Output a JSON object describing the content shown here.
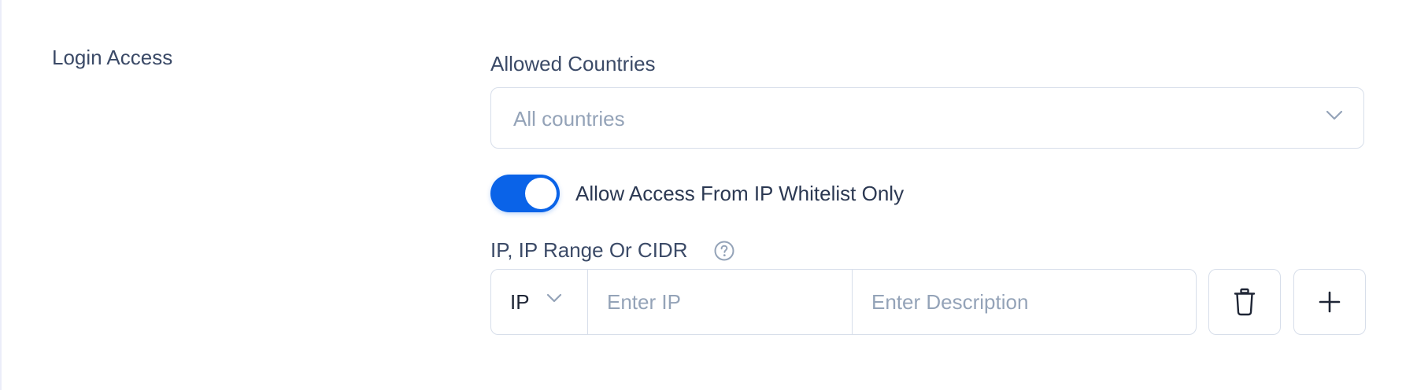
{
  "section": {
    "title": "Login Access"
  },
  "allowed_countries": {
    "label": "Allowed Countries",
    "placeholder": "All countries",
    "icon": "chevron-down-icon"
  },
  "ip_whitelist_toggle": {
    "label": "Allow Access From IP Whitelist Only",
    "enabled": true,
    "color": "#0a63e8"
  },
  "ip_entry": {
    "label": "IP, IP Range Or CIDR",
    "help_icon": "question-circle-icon",
    "type_value": "IP",
    "ip_placeholder": "Enter IP",
    "description_placeholder": "Enter Description",
    "delete_icon": "trash-icon",
    "add_icon": "plus-icon"
  }
}
